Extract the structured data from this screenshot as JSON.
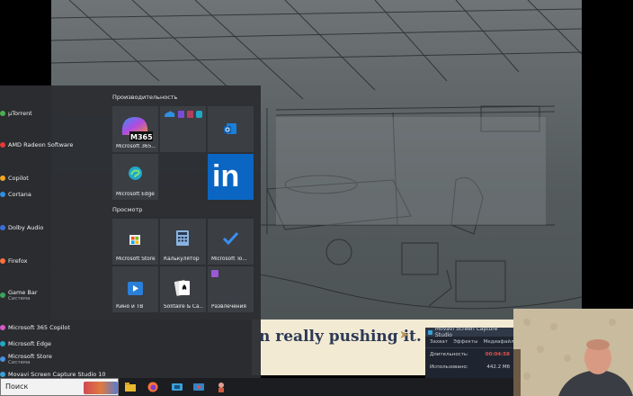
{
  "start_menu": {
    "apps": [
      {
        "label": "µTorrent",
        "sub": "",
        "color": "#4caf50"
      },
      {
        "label": "AMD Radeon Software",
        "sub": "",
        "color": "#e53935"
      },
      {
        "label": "Copilot",
        "sub": "",
        "color": "#f5a623"
      },
      {
        "label": "Cortana",
        "sub": "",
        "color": "#2f8fe0"
      },
      {
        "label": "Dolby Audio",
        "sub": "",
        "color": "#3a6fd8"
      },
      {
        "label": "Firefox",
        "sub": "",
        "color": "#ff7139"
      },
      {
        "label": "Game Bar",
        "sub": "Система",
        "color": "#3ba55c"
      },
      {
        "label": "Microsoft 365 Copilot",
        "sub": "",
        "color": "#d65ac8"
      },
      {
        "label": "Microsoft Edge",
        "sub": "",
        "color": "#1fa8c9"
      },
      {
        "label": "Microsoft Store",
        "sub": "Система",
        "color": "#4a8fe0"
      },
      {
        "label": "Movavi Screen Capture Studio 10",
        "sub": "",
        "color": "#3aa0d8"
      }
    ],
    "groups": {
      "productivity": "Производительность",
      "browse": "Просмотр"
    },
    "tiles": {
      "m365": {
        "label": "Microsoft 365...",
        "badge": "M365"
      },
      "edge": {
        "label": "Microsoft Edge"
      },
      "store": {
        "label": "Microsoft Store"
      },
      "calculator": {
        "label": "Калькулятор"
      },
      "todo": {
        "label": "Microsoft To..."
      },
      "movies": {
        "label": "Кино и ТВ"
      },
      "solitaire": {
        "label": "Solitaire & Ca..."
      },
      "entertainment": {
        "label": "Развлечения"
      },
      "linkedin": {
        "glyph": "in"
      }
    }
  },
  "taskbar": {
    "search_placeholder": "Поиск"
  },
  "banner": {
    "text": "n really pushing it.",
    "arrow": "➤"
  },
  "capture_window": {
    "title": "Movavi Screen Capture Studio",
    "tabs": [
      "Захват",
      "Эффекты",
      "Медиафайлы"
    ],
    "duration_label": "Длительность:",
    "duration_value": "00:04:58",
    "used_label": "Использовано:",
    "used_value": "442.2 Мб"
  },
  "colors": {
    "start_bg": "#2c2e32",
    "tile_bg": "#3b3e43",
    "linkedin_blue": "#0a66c2",
    "accent_red": "#e05050"
  }
}
